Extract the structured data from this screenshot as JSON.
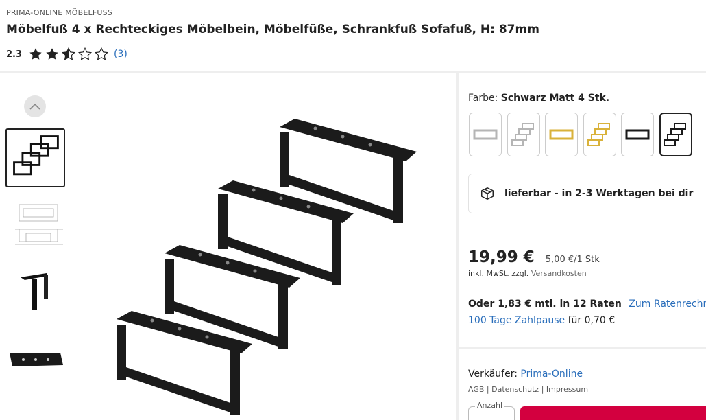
{
  "product": {
    "brand": "PRIMA-ONLINE MÖBELFUSS",
    "title": "Möbelfuß 4 x Rechteckiges Möbelbein, Möbelfüße, Schrankfuß Sofafuß, H: 87mm",
    "rating": "2.3",
    "rating_stars": 2.5,
    "review_count": "(3)"
  },
  "gallery": {
    "up_icon": "chevron-up-icon",
    "thumbnails": [
      "four-black-legs",
      "technical-drawing",
      "single-leg",
      "leg-top-view"
    ],
    "selected_index": 0
  },
  "variant": {
    "label": "Farbe:",
    "selected": "Schwarz Matt 4 Stk.",
    "swatches": [
      "silver-single",
      "silver-set",
      "gold-single",
      "gold-set",
      "black-single",
      "black-set"
    ],
    "selected_index": 5
  },
  "delivery": {
    "icon": "package-icon",
    "text": "lieferbar - in 2-3 Werktagen bei dir"
  },
  "pricing": {
    "price": "19,99 €",
    "unit_price": "5,00 €/1 Stk",
    "tax_prefix": "inkl. MwSt. zzgl.",
    "tax_suffix": "Versandkosten",
    "finance_text": "Oder 1,83 € mtl. in 12 Raten",
    "finance_link": "Zum Ratenrechner",
    "pause_link": "100 Tage Zahlpause",
    "pause_text": "für 0,70 €"
  },
  "seller": {
    "label": "Verkäufer:",
    "name": "Prima-Online",
    "agb": "AGB",
    "datenschutz": "Datenschutz",
    "impressum": "Impressum",
    "separator": "|"
  },
  "purchase": {
    "qty_label": "Anzahl"
  },
  "colors": {
    "link": "#2a6ebb",
    "cta": "#d3003f"
  }
}
